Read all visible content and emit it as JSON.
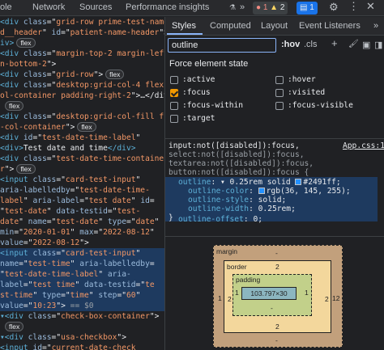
{
  "topbar": {
    "tabs": [
      "ole",
      "Network",
      "Sources",
      "Performance insights"
    ],
    "errors": "1",
    "warnings": "2",
    "issues": "1"
  },
  "elements": {
    "lines": [
      {
        "segs": [
          [
            "t",
            "<div "
          ],
          [
            "a",
            "class"
          ],
          [
            "x",
            "=\""
          ],
          [
            "v",
            "grid-row prime-test-name usa"
          ],
          [
            "x",
            ""
          ]
        ],
        "flex": false,
        "sel": false
      },
      {
        "segs": [
          [
            "v",
            "d__header"
          ],
          [
            "x",
            "\" "
          ],
          [
            "a",
            "id"
          ],
          [
            "x",
            "=\""
          ],
          [
            "v",
            "patient-name-header"
          ],
          [
            "x",
            "\">"
          ]
        ],
        "flex": false,
        "sel": false
      },
      {
        "segs": [
          [
            "t",
            "iv>"
          ]
        ],
        "flex": true,
        "sel": false
      },
      {
        "segs": [
          [
            "t",
            "<div "
          ],
          [
            "a",
            "class"
          ],
          [
            "x",
            "=\""
          ],
          [
            "v",
            "margin-top-2 margin-left-2 m"
          ],
          [
            "x",
            ""
          ]
        ],
        "flex": false,
        "sel": false
      },
      {
        "segs": [
          [
            "v",
            "n-bottom-2"
          ],
          [
            "x",
            "\">"
          ]
        ],
        "flex": false,
        "sel": false
      },
      {
        "segs": [
          [
            "t",
            "<div "
          ],
          [
            "a",
            "class"
          ],
          [
            "x",
            "=\""
          ],
          [
            "v",
            "grid-row"
          ],
          [
            "x",
            "\">"
          ]
        ],
        "flex": true,
        "sel": false
      },
      {
        "segs": [
          [
            "t",
            "<div "
          ],
          [
            "a",
            "class"
          ],
          [
            "x",
            "=\""
          ],
          [
            "v",
            "desktop:grid-col-4 flex-c"
          ],
          [
            "x",
            ""
          ]
        ],
        "flex": false,
        "sel": false
      },
      {
        "segs": [
          [
            "v",
            "ol-container padding-right-2"
          ],
          [
            "x",
            "\">…</div>"
          ]
        ],
        "flex": false,
        "sel": false
      },
      {
        "segs": [
          [
            "t",
            "flex"
          ]
        ],
        "flex": false,
        "sel": false,
        "badgeonly": true
      },
      {
        "segs": [
          [
            "t",
            "<div "
          ],
          [
            "a",
            "class"
          ],
          [
            "x",
            "=\""
          ],
          [
            "v",
            "desktop:grid-col-fill flex"
          ],
          [
            "x",
            ""
          ]
        ],
        "flex": false,
        "sel": false
      },
      {
        "segs": [
          [
            "v",
            "-col-container"
          ],
          [
            "x",
            "\">"
          ]
        ],
        "flex": true,
        "sel": false
      },
      {
        "segs": [
          [
            "t",
            "  <div "
          ],
          [
            "a",
            "id"
          ],
          [
            "x",
            "=\""
          ],
          [
            "v",
            "test-date-time-label"
          ],
          [
            "x",
            "\""
          ]
        ],
        "flex": false,
        "sel": false
      },
      {
        "segs": [
          [
            "t",
            "  <div>"
          ],
          [
            "x",
            "Test date and time"
          ],
          [
            "t",
            "</div>"
          ]
        ],
        "flex": false,
        "sel": false
      },
      {
        "segs": [
          [
            "t",
            "  <div "
          ],
          [
            "a",
            "class"
          ],
          [
            "x",
            "=\""
          ],
          [
            "v",
            "test-date-time-containe"
          ],
          [
            "x",
            ""
          ]
        ],
        "flex": false,
        "sel": false
      },
      {
        "segs": [
          [
            "v",
            "  r"
          ],
          [
            "x",
            "\">"
          ]
        ],
        "flex": true,
        "sel": false
      },
      {
        "segs": [
          [
            "t",
            "    <input "
          ],
          [
            "a",
            "class"
          ],
          [
            "x",
            "=\""
          ],
          [
            "v",
            "card-test-input"
          ],
          [
            "x",
            "\""
          ]
        ],
        "flex": false,
        "sel": false
      },
      {
        "segs": [
          [
            "a",
            "    aria-labelledby"
          ],
          [
            "x",
            "=\""
          ],
          [
            "v",
            "test-date-time-"
          ]
        ],
        "flex": false,
        "sel": false
      },
      {
        "segs": [
          [
            "v",
            "    label"
          ],
          [
            "x",
            "\" "
          ],
          [
            "a",
            "aria-label"
          ],
          [
            "x",
            "=\""
          ],
          [
            "v",
            "test date"
          ],
          [
            "x",
            "\" "
          ],
          [
            "a",
            "id"
          ],
          [
            "x",
            "="
          ]
        ],
        "flex": false,
        "sel": false
      },
      {
        "segs": [
          [
            "x",
            "    \""
          ],
          [
            "v",
            "test-date"
          ],
          [
            "x",
            "\" "
          ],
          [
            "a",
            "data-testid"
          ],
          [
            "x",
            "=\""
          ],
          [
            "v",
            "test-"
          ]
        ],
        "flex": false,
        "sel": false
      },
      {
        "segs": [
          [
            "v",
            "    date"
          ],
          [
            "x",
            "\" "
          ],
          [
            "a",
            "name"
          ],
          [
            "x",
            "=\""
          ],
          [
            "v",
            "test-date"
          ],
          [
            "x",
            "\" "
          ],
          [
            "a",
            "type"
          ],
          [
            "x",
            "=\""
          ],
          [
            "v",
            "date"
          ],
          [
            "x",
            "\""
          ]
        ],
        "flex": false,
        "sel": false
      },
      {
        "segs": [
          [
            "a",
            "    min"
          ],
          [
            "x",
            "=\""
          ],
          [
            "v",
            "2020-01-01"
          ],
          [
            "x",
            "\" "
          ],
          [
            "a",
            "max"
          ],
          [
            "x",
            "=\""
          ],
          [
            "v",
            "2022-08-12"
          ],
          [
            "x",
            "\""
          ]
        ],
        "flex": false,
        "sel": false
      },
      {
        "segs": [
          [
            "a",
            "    value"
          ],
          [
            "x",
            "=\""
          ],
          [
            "v",
            "2022-08-12"
          ],
          [
            "x",
            "\">"
          ]
        ],
        "flex": false,
        "sel": false
      },
      {
        "segs": [
          [
            "t",
            "    <input "
          ],
          [
            "a",
            "class"
          ],
          [
            "x",
            "=\""
          ],
          [
            "v",
            "card-test-input"
          ],
          [
            "x",
            "\""
          ]
        ],
        "flex": false,
        "sel": true
      },
      {
        "segs": [
          [
            "a",
            "    name"
          ],
          [
            "x",
            "=\""
          ],
          [
            "v",
            "test-time"
          ],
          [
            "x",
            "\" "
          ],
          [
            "a",
            "aria-labelledby"
          ],
          [
            "x",
            "="
          ]
        ],
        "flex": false,
        "sel": true
      },
      {
        "segs": [
          [
            "x",
            "    \""
          ],
          [
            "v",
            "test-date-time-label"
          ],
          [
            "x",
            "\" "
          ],
          [
            "a",
            "aria-"
          ]
        ],
        "flex": false,
        "sel": true
      },
      {
        "segs": [
          [
            "a",
            "    label"
          ],
          [
            "x",
            "=\""
          ],
          [
            "v",
            "test time"
          ],
          [
            "x",
            "\" "
          ],
          [
            "a",
            "data-testid"
          ],
          [
            "x",
            "=\""
          ],
          [
            "v",
            "te"
          ]
        ],
        "flex": false,
        "sel": true
      },
      {
        "segs": [
          [
            "v",
            "    st-time"
          ],
          [
            "x",
            "\" "
          ],
          [
            "a",
            "type"
          ],
          [
            "x",
            "=\""
          ],
          [
            "v",
            "time"
          ],
          [
            "x",
            "\" "
          ],
          [
            "a",
            "step"
          ],
          [
            "x",
            "=\""
          ],
          [
            "v",
            "60"
          ],
          [
            "x",
            "\""
          ]
        ],
        "flex": false,
        "sel": true
      },
      {
        "segs": [
          [
            "a",
            "    value"
          ],
          [
            "x",
            "=\""
          ],
          [
            "v",
            "10:23"
          ],
          [
            "x",
            "\">"
          ],
          [
            "g",
            " == $0"
          ]
        ],
        "flex": false,
        "sel": true
      },
      {
        "segs": [
          [
            "t",
            "  ▾<div "
          ],
          [
            "a",
            "class"
          ],
          [
            "x",
            "=\""
          ],
          [
            "v",
            "check-box-container"
          ],
          [
            "x",
            "\">"
          ]
        ],
        "flex": false,
        "sel": false
      },
      {
        "segs": [
          [
            "t",
            "flex"
          ]
        ],
        "flex": false,
        "sel": false,
        "badgeonly": true
      },
      {
        "segs": [
          [
            "t",
            "    ▾<div "
          ],
          [
            "a",
            "class"
          ],
          [
            "x",
            "=\""
          ],
          [
            "v",
            "usa-checkbox"
          ],
          [
            "x",
            "\">"
          ]
        ],
        "flex": false,
        "sel": false
      },
      {
        "segs": [
          [
            "t",
            "      <input "
          ],
          [
            "a",
            "id"
          ],
          [
            "x",
            "=\""
          ],
          [
            "v",
            "current-date-check"
          ]
        ],
        "flex": false,
        "sel": false
      }
    ]
  },
  "styles": {
    "tabs": [
      "Styles",
      "Computed",
      "Layout",
      "Event Listeners",
      "»"
    ],
    "filter_value": "outline",
    "hov": ":hov",
    "cls": ".cls",
    "force_state_title": "Force element state",
    "states": [
      {
        "label": ":active",
        "checked": false
      },
      {
        "label": ":hover",
        "checked": false
      },
      {
        "label": ":focus",
        "checked": true
      },
      {
        "label": ":visited",
        "checked": false
      },
      {
        "label": ":focus-within",
        "checked": false
      },
      {
        "label": ":focus-visible",
        "checked": false
      },
      {
        "label": ":target",
        "checked": false
      }
    ],
    "rule": {
      "selector1": "input:not([disabled]):focus,",
      "selector2": "select:not([disabled]):focus,",
      "selector3": "textarea:not([disabled]):focus,",
      "selector4": "button:not([disabled]):focus {",
      "source": "App.css:1",
      "p_outline": "outline",
      "v_outline": "0.25rem  solid",
      "v_outline_color_hex": "#2491ff;",
      "p_color": "outline-color",
      "v_color": "rgb(36, 145, 255);",
      "p_style": "outline-style",
      "v_style": "solid;",
      "p_width": "outline-width",
      "v_width": "0.25rem;",
      "close": "}",
      "p_offset": "outline-offset",
      "v_offset": "0;",
      "swatch": "#2491ff"
    },
    "boxmodel": {
      "margin_label": "margin",
      "margin_top": "-",
      "margin_left": "-",
      "margin_right": "-",
      "margin_bottom": "-",
      "border_label": "border",
      "border_top": "2",
      "border_left": "2",
      "border_right": "2",
      "border_bottom": "2",
      "padding_label": "padding",
      "padding_top": "-",
      "padding_left": "1",
      "padding_right": "1",
      "padding_bottom": "-",
      "content": "103.797×30",
      "outside_left": "1",
      "outside_right": "12"
    }
  }
}
